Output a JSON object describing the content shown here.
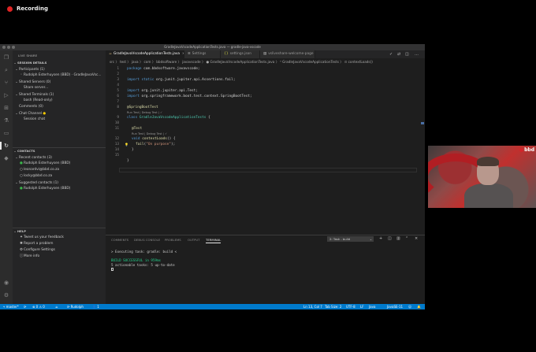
{
  "recording": {
    "label": "Recording",
    "color": "#e02424"
  },
  "window": {
    "title": "GradleJavaVscodeApplicationTests.java — gradle-java-vscode"
  },
  "activity_bar": {
    "icons": [
      "files-icon",
      "search-icon",
      "source-control-icon",
      "run-debug-icon",
      "extensions-icon",
      "test-icon",
      "remote-explorer-icon",
      "live-share-icon",
      "gitlens-icon",
      "account-icon",
      "settings-gear-icon"
    ]
  },
  "sidebar": {
    "title": "LIVE SHARE",
    "session_details": "SESSION DETAILS",
    "participants": "Participants (1)",
    "participant_name": "Rudolph Esterhuysen (BBD) · GradleJavaVsc...",
    "shared_servers": "Shared Servers (0)",
    "share_server": "Share server...",
    "shared_terminals": "Shared Terminals (1)",
    "bash_terminal": "bash (Read-only)",
    "comments": "Comments (0)",
    "chat_channel": "Chat Channel",
    "session_chat": "Session chat",
    "contacts_header": "CONTACTS",
    "recent_contacts": "Recent contacts (3)",
    "recent_list": [
      "Rudolph Esterhuysen (BBD)",
      "leonardvi@bbd.co.za",
      "locky@bbd.co.za"
    ],
    "suggested_contacts": "Suggested contacts (1)",
    "suggested_list": [
      "Rudolph Esterhuysen (BBD)"
    ],
    "help_header": "HELP",
    "help_items": [
      "Tweet us your feedback",
      "Report a problem",
      "Configure Settings",
      "More info"
    ]
  },
  "tabs": [
    {
      "label": "GradleJavaVscodeApplicationTests.java",
      "active": true
    },
    {
      "label": "Settings",
      "active": false
    },
    {
      "label": "settings.json",
      "active": false
    },
    {
      "label": "vsliveshare-welcome-page",
      "active": false
    }
  ],
  "breadcrumb": "src 〉 test 〉 java 〉 com 〉 bbdsoftware 〉 javavscode 〉 ● GradleJavaVscodeApplicationTests.java 〉 ⁰ GradleJavaVscodeApplicationTests 〉 ⊙ contextLoads()",
  "code": {
    "line_numbers": [
      "1",
      "2",
      "3",
      "4",
      "5",
      "6",
      "7",
      "8",
      "9",
      "10",
      "11",
      "12",
      "13",
      "14",
      "15"
    ],
    "l1_kw": "package",
    "l1_rest": " com.bbdsoftware.javavscode;",
    "l3_kw": "import static",
    "l3_rest": " org.junit.jupiter.api.Assertions.fail;",
    "l5_kw": "import",
    "l5_rest": " org.junit.jupiter.api.Test;",
    "l6_kw": "import",
    "l6_rest": " org.springframework.boot.test.context.SpringBootTest;",
    "l8_an": "@SpringBootTest",
    "lens_class": "Run Test | Debug Test | ✓",
    "l9_kw": "class",
    "l9_ty": " GradleJavaVscodeApplicationTests",
    "l9_rest": " {",
    "l11_an": "@Test",
    "lens_method": "Run Test | Debug Test | ✓",
    "l12_kw": "void",
    "l12_fn": " contextLoads",
    "l12_rest": "() {",
    "l13_fn": "fail",
    "l13_p1": "(",
    "l13_st": "\"On purpose\"",
    "l13_p2": ");",
    "l14_text": "}",
    "l16_text": "}"
  },
  "panel": {
    "tabs": [
      "COMMENTS",
      "DEBUG CONSOLE",
      "PROBLEMS",
      "OUTPUT",
      "TERMINAL"
    ],
    "active_tab": "TERMINAL",
    "terminal_select": "2: Task - build",
    "terminal_lines": [
      "> Executing task: gradle: build <",
      "",
      "BUILD SUCCESSFUL in 959ms",
      "5 actionable tasks: 5 up-to-date"
    ]
  },
  "statusbar": {
    "branch": "master*",
    "sync": "⟳",
    "problems": "⊗ 0 ⚠ 0",
    "java": "☕",
    "user": "Rudolph",
    "people": "1",
    "position": "Ln 13, Col 7",
    "tab_size": "Tab Size: 2",
    "encoding": "UTF-8",
    "eol": "LF",
    "language": "Java",
    "jdk": "JavaSE-11",
    "bg_color": "#007acc"
  },
  "webcam": {
    "logo_text": "bbd"
  }
}
